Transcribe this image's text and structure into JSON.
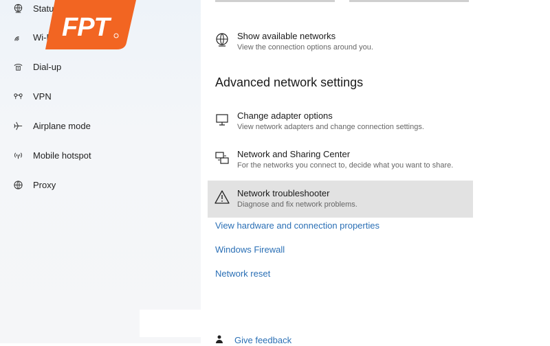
{
  "sidebar": {
    "items": [
      {
        "label": "Status",
        "icon": "status-globe-icon"
      },
      {
        "label": "Wi-Fi",
        "icon": "wifi-icon"
      },
      {
        "label": "Dial-up",
        "icon": "dialup-icon"
      },
      {
        "label": "VPN",
        "icon": "vpn-icon"
      },
      {
        "label": "Airplane mode",
        "icon": "airplane-icon"
      },
      {
        "label": "Mobile hotspot",
        "icon": "hotspot-icon"
      },
      {
        "label": "Proxy",
        "icon": "proxy-globe-icon"
      }
    ]
  },
  "logo": {
    "text": "FPT",
    "color": "#f26522"
  },
  "main": {
    "show_networks": {
      "title": "Show available networks",
      "desc": "View the connection options around you."
    },
    "section_title": "Advanced network settings",
    "settings": [
      {
        "title": "Change adapter options",
        "desc": "View network adapters and change connection settings."
      },
      {
        "title": "Network and Sharing Center",
        "desc": "For the networks you connect to, decide what you want to share."
      },
      {
        "title": "Network troubleshooter",
        "desc": "Diagnose and fix network problems."
      }
    ],
    "links": {
      "hardware": "View hardware and connection properties",
      "firewall": "Windows Firewall",
      "reset": "Network reset"
    },
    "feedback": "Give feedback"
  },
  "colors": {
    "accent_link": "#2a6fb5",
    "highlight": "#e2e2e2"
  }
}
